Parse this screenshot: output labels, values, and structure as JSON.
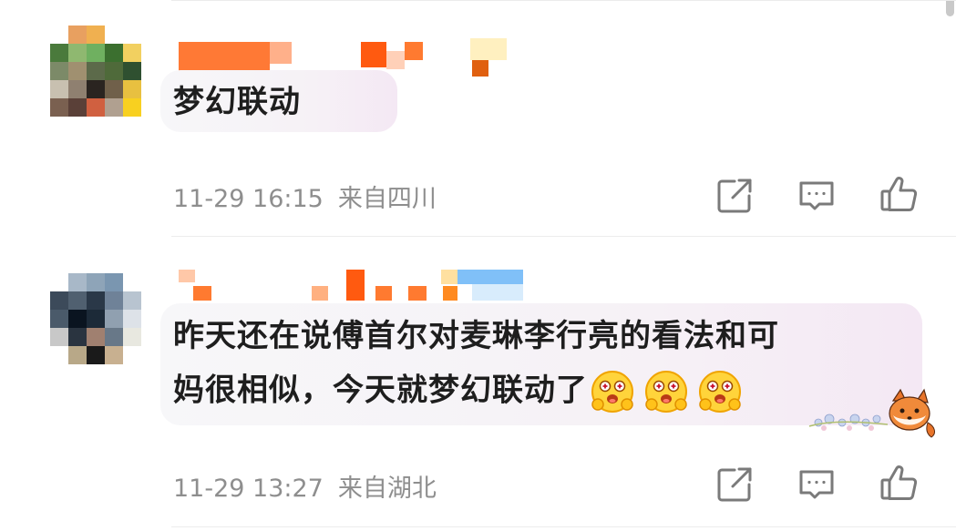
{
  "comments": [
    {
      "text": "梦幻联动",
      "time": "11-29 16:15",
      "location": "来自四川",
      "emojis": []
    },
    {
      "text_line1": "昨天还在说傅首尔对麦琳李行亮的看法和可",
      "text_line2": "妈很相似，今天就梦幻联动了",
      "time": "11-29 13:27",
      "location": "来自湖北",
      "emojis": [
        "happy-face",
        "happy-face",
        "happy-face"
      ]
    }
  ],
  "actions": [
    "share-icon",
    "comment-icon",
    "like-icon"
  ],
  "colors": {
    "meta": "#8e8e8e",
    "text": "#1e1e1e",
    "bubble": "#f6f1f6",
    "divider": "#ececec",
    "username_blur": "#ff6a1f"
  }
}
